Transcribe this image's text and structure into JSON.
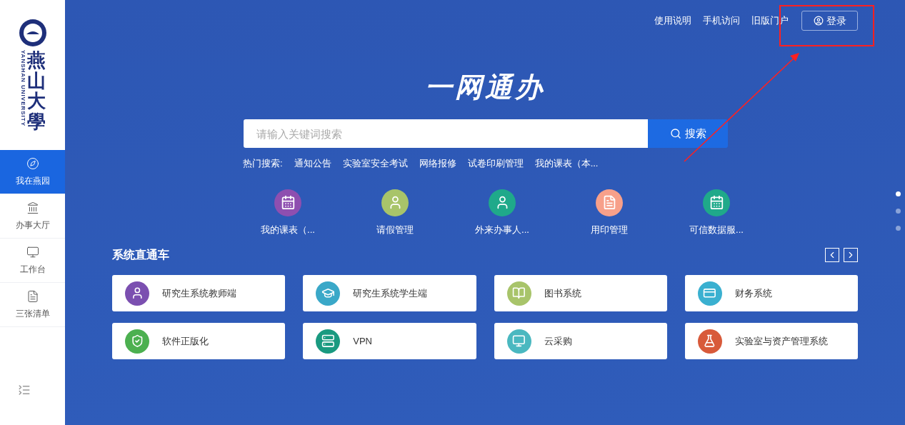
{
  "logo": {
    "name_cn": "燕山大學",
    "name_en": "YANSHAN UNIVERSITY"
  },
  "sidebar": {
    "items": [
      {
        "label": "我在燕园",
        "kind": "compass",
        "selected": true
      },
      {
        "label": "办事大厅",
        "kind": "hall",
        "selected": false
      },
      {
        "label": "工作台",
        "kind": "monitor",
        "selected": false
      },
      {
        "label": "三张清单",
        "kind": "list",
        "selected": false
      }
    ]
  },
  "top_links": [
    "使用说明",
    "手机访问",
    "旧版门户"
  ],
  "login_button": "登录",
  "title": "一网通办",
  "search": {
    "placeholder": "请输入关键词搜索",
    "button": "搜索"
  },
  "hot_search": {
    "label": "热门搜索:",
    "items": [
      "通知公告",
      "实验室安全考试",
      "网络报修",
      "试卷印刷管理",
      "我的课表（本..."
    ]
  },
  "quick_apps": [
    {
      "label": "我的课表（...",
      "kind": "calendar",
      "color": "#8e4fb0"
    },
    {
      "label": "请假管理",
      "kind": "person",
      "color": "#a8c46a"
    },
    {
      "label": "外来办事人...",
      "kind": "person",
      "color": "#1fa98a"
    },
    {
      "label": "用印管理",
      "kind": "document",
      "color": "#f7a08a"
    },
    {
      "label": "可信数据服...",
      "kind": "calendar",
      "color": "#1fa98a"
    }
  ],
  "systems": {
    "title": "系统直通车",
    "items": [
      {
        "label": "研究生系统教师端",
        "kind": "person",
        "color": "#7b4fb0"
      },
      {
        "label": "研究生系统学生端",
        "kind": "graduate",
        "color": "#3aa8c8"
      },
      {
        "label": "图书系统",
        "kind": "books",
        "color": "#a8c46a"
      },
      {
        "label": "财务系统",
        "kind": "card",
        "color": "#3ab0d0"
      },
      {
        "label": "软件正版化",
        "kind": "shield",
        "color": "#4cb050"
      },
      {
        "label": "VPN",
        "kind": "server",
        "color": "#1a9a80"
      },
      {
        "label": "云采购",
        "kind": "monitor",
        "color": "#4ab8c0"
      },
      {
        "label": "实验室与资产管理系统",
        "kind": "lab",
        "color": "#d85a3a"
      }
    ]
  },
  "pager": [
    {
      "selected": true
    },
    {
      "selected": false
    },
    {
      "selected": false
    }
  ]
}
